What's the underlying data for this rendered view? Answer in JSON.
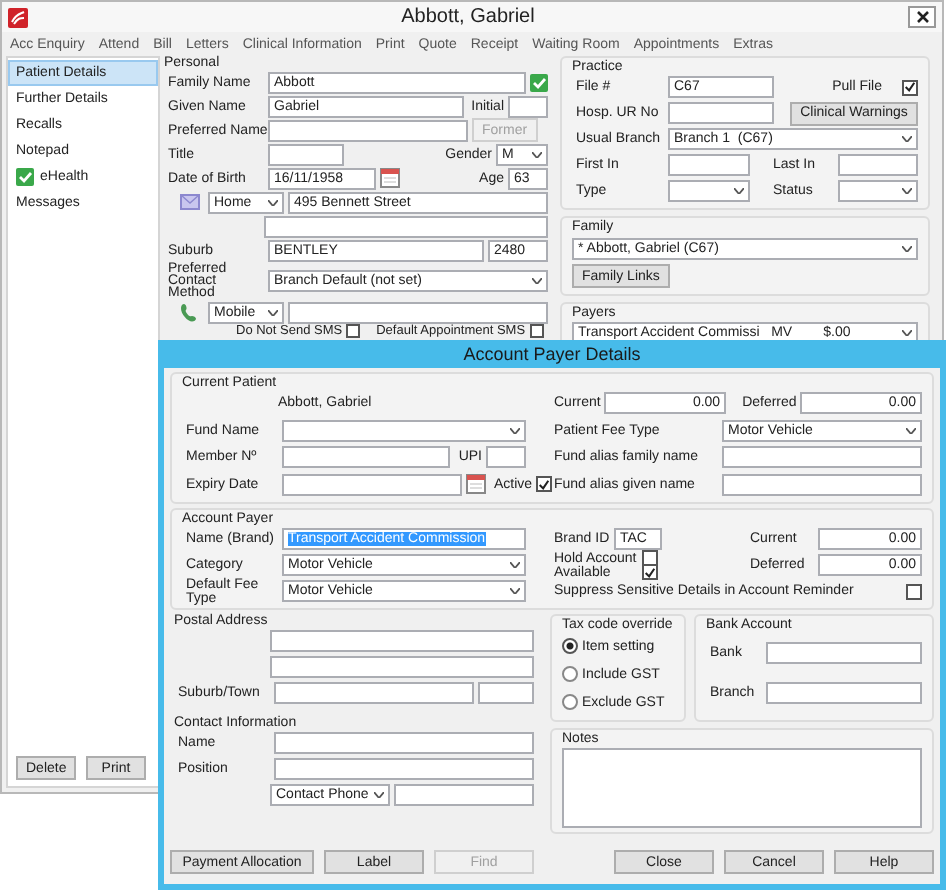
{
  "window": {
    "title": "Abbott, Gabriel"
  },
  "menu": [
    "Acc Enquiry",
    "Attend",
    "Bill",
    "Letters",
    "Clinical Information",
    "Print",
    "Quote",
    "Receipt",
    "Waiting Room",
    "Appointments",
    "Extras"
  ],
  "sidebar": {
    "items": [
      {
        "label": "Patient Details",
        "selected": true,
        "kind": "plain"
      },
      {
        "label": "Further Details",
        "selected": false,
        "kind": "plain"
      },
      {
        "label": "Recalls",
        "selected": false,
        "kind": "plain"
      },
      {
        "label": "Notepad",
        "selected": false,
        "kind": "plain"
      },
      {
        "label": "eHealth",
        "selected": false,
        "kind": "verified"
      },
      {
        "label": "Messages",
        "selected": false,
        "kind": "plain"
      }
    ],
    "buttons": [
      "Delete",
      "Print"
    ]
  },
  "personal": {
    "title": "Personal",
    "rows": [
      [
        {
          "kind": "label",
          "text": "Family Name"
        },
        {
          "kind": "field",
          "value": "Abbott"
        },
        {
          "kind": "tick"
        }
      ],
      [
        {
          "kind": "label",
          "text": "Given Name"
        },
        {
          "kind": "field",
          "value": "Gabriel"
        },
        {
          "kind": "label",
          "text": "Initial"
        },
        {
          "kind": "short"
        }
      ],
      [
        {
          "kind": "label",
          "text": "Preferred Name"
        },
        {
          "kind": "field"
        },
        {
          "kind": "button",
          "text": "Former",
          "disabled": true
        }
      ],
      [
        {
          "kind": "label",
          "text": "Title"
        },
        {
          "kind": "field"
        },
        {
          "kind": "label",
          "text": "Gender"
        },
        {
          "kind": "small_combo",
          "value": "M"
        }
      ],
      [
        {
          "kind": "label",
          "text": "Date of Birth"
        },
        {
          "kind": "field",
          "value": "16/11/1958"
        },
        {
          "kind": "calendar"
        },
        {
          "kind": "label",
          "text": "Age"
        },
        {
          "kind": "short",
          "value": "63"
        }
      ],
      [
        {
          "kind": "mail"
        },
        {
          "kind": "small_combo",
          "value": "Home"
        },
        {
          "kind": "field",
          "value": "495 Bennett Street"
        }
      ],
      [
        {
          "kind": "spacer"
        },
        {
          "kind": "field"
        }
      ],
      [
        {
          "kind": "label",
          "text": "Suburb"
        },
        {
          "kind": "field",
          "value": "BENTLEY"
        },
        {
          "kind": "short",
          "value": "2480"
        }
      ],
      [
        {
          "kind": "label",
          "text": "Preferred Contact Method"
        },
        {
          "kind": "combo",
          "value": "Branch Default (not set)"
        }
      ],
      [
        {
          "kind": "phone"
        },
        {
          "kind": "small_combo",
          "value": "Mobile"
        },
        {
          "kind": "field"
        }
      ],
      [
        {
          "kind": "spacer"
        },
        {
          "kind": "label",
          "text": "Do Not Send SMS"
        },
        {
          "kind": "check",
          "checked": false
        },
        {
          "kind": "label",
          "text": "Default Appointment SMS"
        },
        {
          "kind": "check",
          "checked": false
        }
      ]
    ]
  },
  "practice": {
    "title": "Practice",
    "rows": [
      [
        {
          "kind": "label",
          "text": "File #"
        },
        {
          "kind": "field",
          "value": "C67"
        },
        {
          "kind": "label",
          "text": "Pull File"
        },
        {
          "kind": "check",
          "checked": true
        }
      ],
      [
        {
          "kind": "label",
          "text": "Hosp. UR No"
        },
        {
          "kind": "field"
        },
        {
          "kind": "button",
          "text": "Clinical Warnings",
          "disabled": false
        }
      ],
      [
        {
          "kind": "label",
          "text": "Usual Branch"
        },
        {
          "kind": "combo",
          "value": "Branch 1  (C67)"
        }
      ],
      [
        {
          "kind": "label",
          "text": "First In"
        },
        {
          "kind": "field"
        },
        {
          "kind": "label",
          "text": "Last In"
        },
        {
          "kind": "field"
        }
      ],
      [
        {
          "kind": "label",
          "text": "Type"
        },
        {
          "kind": "combo"
        },
        {
          "kind": "label",
          "text": "Status"
        },
        {
          "kind": "combo"
        }
      ]
    ]
  },
  "family": {
    "title": "Family",
    "rows": [
      [
        {
          "kind": "combo",
          "value": "* Abbott, Gabriel (C67)"
        }
      ],
      [
        {
          "kind": "button",
          "text": "Family Links",
          "disabled": false
        }
      ]
    ]
  },
  "payers": {
    "title": "Payers",
    "rows": [
      [
        {
          "kind": "combo",
          "value": "Transport Accident Commissi   MV        $.00"
        }
      ]
    ]
  },
  "dialog": {
    "title": "Account Payer Details",
    "current_patient": {
      "title": "Current Patient",
      "left": [
        [
          {
            "kind": "spacer"
          },
          {
            "kind": "text",
            "text": "Abbott, Gabriel"
          }
        ],
        [
          {
            "kind": "label",
            "text": "Fund Name"
          },
          {
            "kind": "combo"
          }
        ],
        [
          {
            "kind": "label",
            "text": "Member Nº"
          },
          {
            "kind": "field"
          },
          {
            "kind": "label",
            "text": "UPI"
          },
          {
            "kind": "short"
          }
        ],
        [
          {
            "kind": "label",
            "text": "Expiry Date"
          },
          {
            "kind": "field"
          },
          {
            "kind": "calendar"
          },
          {
            "kind": "label",
            "text": "Active"
          },
          {
            "kind": "check",
            "checked": true
          }
        ]
      ],
      "right": [
        [
          {
            "kind": "label",
            "text": "Current"
          },
          {
            "kind": "amount",
            "value": "0.00"
          },
          {
            "kind": "label",
            "text": "Deferred"
          },
          {
            "kind": "amount",
            "value": "0.00"
          }
        ],
        [
          {
            "kind": "label",
            "text": "Patient Fee Type"
          },
          {
            "kind": "combo",
            "value": "Motor Vehicle"
          }
        ],
        [
          {
            "kind": "label",
            "text": "Fund alias family name"
          },
          {
            "kind": "field"
          }
        ],
        [
          {
            "kind": "label",
            "text": "Fund alias given name"
          },
          {
            "kind": "field"
          }
        ]
      ]
    },
    "account_payer": {
      "title": "Account Payer",
      "left": [
        [
          {
            "kind": "label",
            "text": "Name (Brand)"
          },
          {
            "kind": "field",
            "value": "Transport Accident Commission",
            "highlighted": true
          }
        ],
        [
          {
            "kind": "label",
            "text": "Category"
          },
          {
            "kind": "combo",
            "value": "Motor Vehicle"
          }
        ],
        [
          {
            "kind": "label",
            "text": "Default Fee Type"
          },
          {
            "kind": "combo",
            "value": "Motor Vehicle"
          }
        ]
      ],
      "right": [
        [
          {
            "kind": "label",
            "text": "Brand ID"
          },
          {
            "kind": "short",
            "value": "TAC"
          },
          {
            "kind": "label",
            "text": "Current"
          },
          {
            "kind": "amount",
            "value": "0.00"
          }
        ],
        [
          {
            "kind": "check_stack",
            "items": [
              {
                "label": "Hold Account",
                "checked": false
              },
              {
                "label": "Available",
                "checked": true
              }
            ]
          },
          {
            "kind": "label",
            "text": "Deferred"
          },
          {
            "kind": "amount",
            "value": "0.00"
          }
        ],
        [
          {
            "kind": "label",
            "text": "Suppress Sensitive Details in Account Reminder"
          },
          {
            "kind": "check",
            "checked": false
          }
        ]
      ]
    },
    "postal_address": {
      "title": "Postal Address",
      "rows": [
        [
          {
            "kind": "spacer"
          },
          {
            "kind": "field"
          }
        ],
        [
          {
            "kind": "spacer"
          },
          {
            "kind": "field"
          }
        ],
        [
          {
            "kind": "label",
            "text": "Suburb/Town"
          },
          {
            "kind": "field"
          },
          {
            "kind": "short"
          }
        ]
      ]
    },
    "contact_information": {
      "title": "Contact Information",
      "rows": [
        [
          {
            "kind": "label",
            "text": "Name"
          },
          {
            "kind": "field"
          }
        ],
        [
          {
            "kind": "label",
            "text": "Position"
          },
          {
            "kind": "field"
          }
        ],
        [
          {
            "kind": "spacer"
          },
          {
            "kind": "small_combo",
            "value": "Contact Phone"
          },
          {
            "kind": "field"
          }
        ]
      ]
    },
    "tax_code_override": {
      "title": "Tax code override",
      "options": [
        {
          "label": "Item setting",
          "selected": true
        },
        {
          "label": "Include GST",
          "selected": false
        },
        {
          "label": "Exclude GST",
          "selected": false
        }
      ]
    },
    "bank_account": {
      "title": "Bank Account",
      "rows": [
        [
          {
            "kind": "label",
            "text": "Bank"
          },
          {
            "kind": "field"
          }
        ],
        [
          {
            "kind": "label",
            "text": "Branch"
          },
          {
            "kind": "field"
          }
        ]
      ]
    },
    "notes": {
      "title": "Notes"
    },
    "buttons_left": [
      {
        "label": "Payment Allocation",
        "disabled": false
      },
      {
        "label": "Label",
        "disabled": false
      },
      {
        "label": "Find",
        "disabled": true
      }
    ],
    "buttons_right": [
      {
        "label": "Close",
        "disabled": false
      },
      {
        "label": "Cancel",
        "disabled": false
      },
      {
        "label": "Help",
        "disabled": false
      }
    ]
  }
}
